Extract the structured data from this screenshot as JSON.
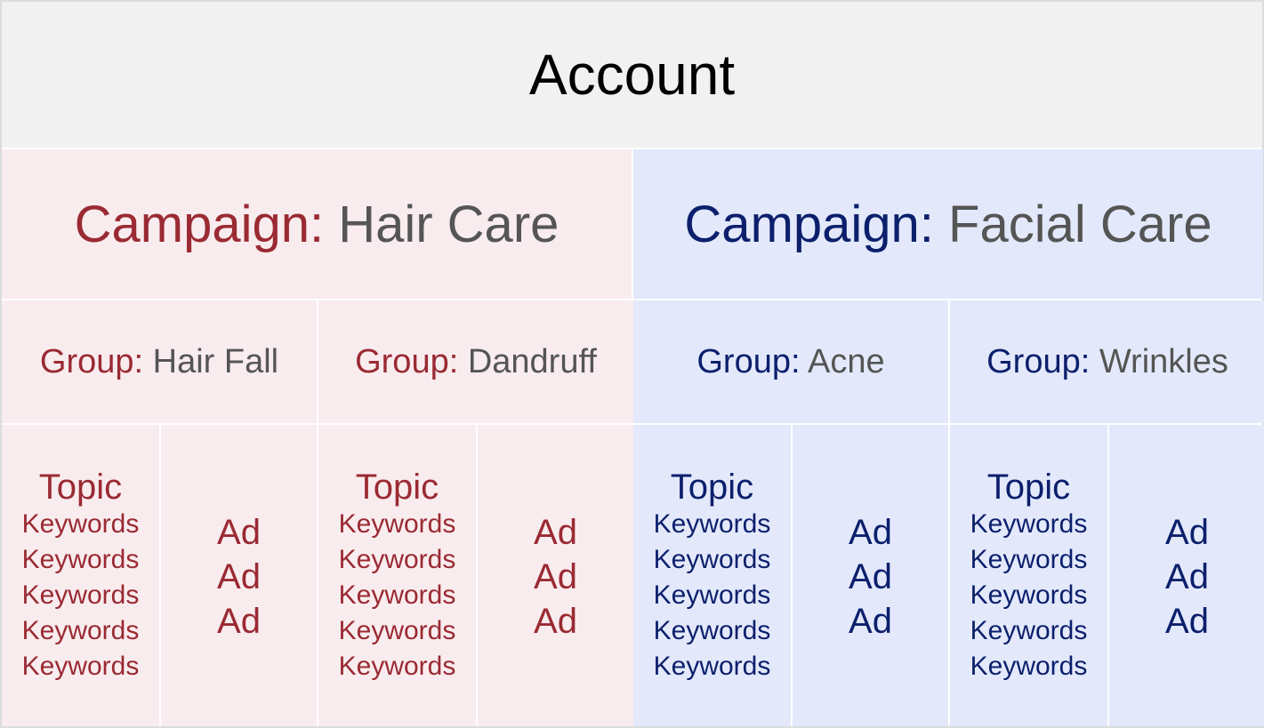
{
  "account": {
    "label": "Account"
  },
  "campaigns": [
    {
      "prefix": "Campaign:",
      "name": "Hair Care",
      "color": "#9a2a33",
      "groups": [
        {
          "prefix": "Group:",
          "name": "Hair Fall",
          "topic": "Topic",
          "keywords": [
            "Keywords",
            "Keywords",
            "Keywords",
            "Keywords",
            "Keywords"
          ],
          "ads": [
            "Ad",
            "Ad",
            "Ad"
          ]
        },
        {
          "prefix": "Group:",
          "name": "Dandruff",
          "topic": "Topic",
          "keywords": [
            "Keywords",
            "Keywords",
            "Keywords",
            "Keywords",
            "Keywords"
          ],
          "ads": [
            "Ad",
            "Ad",
            "Ad"
          ]
        }
      ]
    },
    {
      "prefix": "Campaign:",
      "name": "Facial Care",
      "color": "#0c1f6c",
      "groups": [
        {
          "prefix": "Group:",
          "name": "Acne",
          "topic": "Topic",
          "keywords": [
            "Keywords",
            "Keywords",
            "Keywords",
            "Keywords",
            "Keywords"
          ],
          "ads": [
            "Ad",
            "Ad",
            "Ad"
          ]
        },
        {
          "prefix": "Group:",
          "name": "Wrinkles",
          "topic": "Topic",
          "keywords": [
            "Keywords",
            "Keywords",
            "Keywords",
            "Keywords",
            "Keywords"
          ],
          "ads": [
            "Ad",
            "Ad",
            "Ad"
          ]
        }
      ]
    }
  ]
}
